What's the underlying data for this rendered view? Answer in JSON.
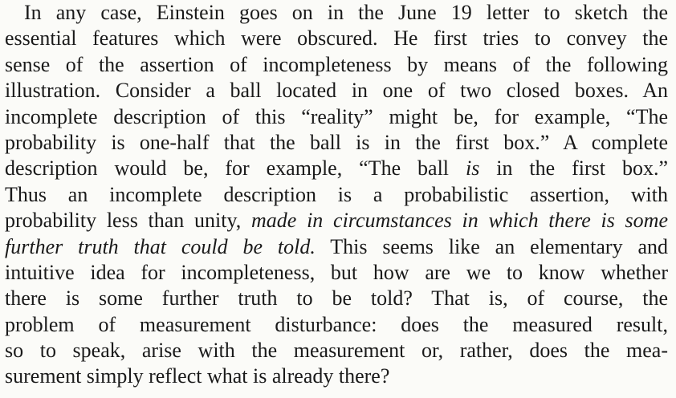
{
  "paragraph": {
    "lines": [
      {
        "text": "In any case, Einstein goes on in the June 19 letter to sketch the"
      },
      {
        "text": "essential features which were obscured. He first tries to convey the"
      },
      {
        "text": "sense of the assertion of incompleteness by means of the following"
      },
      {
        "text": "illustration. Consider a ball located in one of two closed boxes. An"
      },
      {
        "text": "incomplete description of this “reality” might be, for example, “The"
      },
      {
        "text": "probability is one-half that the ball is in the first box.” A complete"
      },
      {
        "before": "description would be, for example, “The ball ",
        "italic": "is",
        "after": " in the first box.”"
      },
      {
        "text": "Thus an incomplete description is a probabilistic assertion, with"
      },
      {
        "before": "probability less than unity, ",
        "italic": "made in circumstances in which there is some",
        "after": ""
      },
      {
        "before": "",
        "italic": "further truth that could be told.",
        "after": " This seems like an elementary and"
      },
      {
        "text": "intuitive idea for incompleteness, but how are we to know whether"
      },
      {
        "text": "there is some further truth to be told? That is, of course, the"
      },
      {
        "text": "problem of measurement disturbance: does the measured result,"
      },
      {
        "text": "so to speak, arise with the measurement or, rather, does the mea-"
      },
      {
        "text": "surement simply reflect what is already there?"
      }
    ]
  }
}
